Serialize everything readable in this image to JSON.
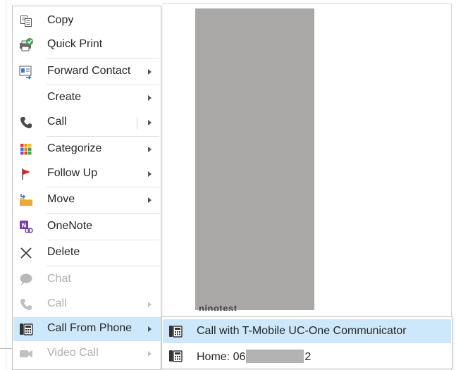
{
  "menu": {
    "items": [
      {
        "label": "Copy",
        "icon": "copy-icon",
        "submenu": false,
        "disabled": false
      },
      {
        "label": "Quick Print",
        "icon": "quick-print-icon",
        "submenu": false,
        "disabled": false
      },
      {
        "label": "Forward Contact",
        "icon": "forward-contact-icon",
        "submenu": true,
        "disabled": false
      },
      {
        "label": "Create",
        "icon": "",
        "submenu": true,
        "disabled": false
      },
      {
        "label": "Call",
        "icon": "phone-icon",
        "submenu": true,
        "disabled": false
      },
      {
        "label": "Categorize",
        "icon": "categorize-icon",
        "submenu": true,
        "disabled": false
      },
      {
        "label": "Follow Up",
        "icon": "flag-icon",
        "submenu": true,
        "disabled": false
      },
      {
        "label": "Move",
        "icon": "move-folder-icon",
        "submenu": true,
        "disabled": false
      },
      {
        "label": "OneNote",
        "icon": "onenote-icon",
        "submenu": false,
        "disabled": false
      },
      {
        "label": "Delete",
        "icon": "delete-x-icon",
        "submenu": false,
        "disabled": false
      },
      {
        "label": "Chat",
        "icon": "chat-bubble-icon",
        "submenu": false,
        "disabled": true
      },
      {
        "label": "Call",
        "icon": "phone-icon",
        "submenu": true,
        "disabled": true
      },
      {
        "label": "Call From Phone",
        "icon": "desk-phone-icon",
        "submenu": true,
        "disabled": false,
        "highlighted": true
      },
      {
        "label": "Video Call",
        "icon": "video-camera-icon",
        "submenu": true,
        "disabled": true
      }
    ]
  },
  "submenu": {
    "items": [
      {
        "label": "Call with T-Mobile UC-One Communicator",
        "icon": "desk-phone-icon",
        "highlighted": true
      },
      {
        "label_prefix": "Home: 06",
        "label_suffix": "2",
        "icon": "desk-phone-icon"
      }
    ]
  },
  "background": {
    "peek_text": "ninotest"
  },
  "colors": {
    "highlight": "#cde8fb",
    "disabled_text": "#b0b0b0",
    "redaction": "#aaa7a7"
  }
}
